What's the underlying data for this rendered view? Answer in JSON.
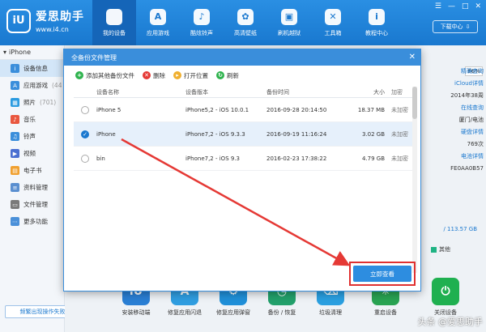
{
  "app": {
    "name": "爱思助手",
    "url": "www.i4.cn",
    "badge": "iU"
  },
  "nav": [
    {
      "label": "我的设备",
      "icon": "apple-icon",
      "glyph": ""
    },
    {
      "label": "应用游戏",
      "icon": "appstore-icon",
      "glyph": "A"
    },
    {
      "label": "酷炫铃声",
      "icon": "bell-icon",
      "glyph": "♪"
    },
    {
      "label": "高清壁纸",
      "icon": "flower-icon",
      "glyph": "✿"
    },
    {
      "label": "刷机越狱",
      "icon": "box-icon",
      "glyph": "▣"
    },
    {
      "label": "工具箱",
      "icon": "tools-icon",
      "glyph": "✕"
    },
    {
      "label": "教程中心",
      "icon": "info-icon",
      "glyph": "i"
    }
  ],
  "window_controls": [
    "☰",
    "—",
    "□",
    "✕"
  ],
  "download_label": "下载中心",
  "sidebar": {
    "device": "iPhone",
    "items": [
      {
        "label": "设备信息",
        "count": "",
        "color": "#3a8edb",
        "glyph": "i"
      },
      {
        "label": "应用游戏",
        "count": "(44",
        "color": "#3a8edb",
        "glyph": "A"
      },
      {
        "label": "照片",
        "count": "(701)",
        "color": "#2b9be0",
        "glyph": "▦"
      },
      {
        "label": "音乐",
        "count": "",
        "color": "#e9573f",
        "glyph": "♪"
      },
      {
        "label": "铃声",
        "count": "",
        "color": "#3a8edb",
        "glyph": "♫"
      },
      {
        "label": "视频",
        "count": "",
        "color": "#4a6fd1",
        "glyph": "▶"
      },
      {
        "label": "电子书",
        "count": "",
        "color": "#f0a030",
        "glyph": "▤"
      },
      {
        "label": "资料管理",
        "count": "",
        "color": "#5a8fd0",
        "glyph": "≡"
      },
      {
        "label": "文件管理",
        "count": "",
        "color": "#7a7a7a",
        "glyph": "▭"
      },
      {
        "label": "更多功能",
        "count": "",
        "color": "#4a90d9",
        "glyph": "⋯"
      }
    ],
    "feedback": "频繁出现操作失败？"
  },
  "right_panel": {
    "percent": "86%",
    "lines": [
      {
        "text": "",
        "val": "精确查询",
        "link": true
      },
      {
        "text": "",
        "val": "iCloud详情",
        "link": true
      },
      {
        "text": "",
        "val": "2014年38周",
        "link": false
      },
      {
        "text": "",
        "val": "在线查询",
        "link": true
      },
      {
        "text": "",
        "val": "厦门/电池",
        "link": false
      },
      {
        "text": "",
        "val": "硬盘详情",
        "link": true
      },
      {
        "text": "",
        "val": "769次",
        "link": false
      },
      {
        "text": "",
        "val": "电池详情",
        "link": true
      },
      {
        "text": "",
        "val": "FE0AA0B57",
        "link": false
      }
    ],
    "storage": "/ 113.57 GB",
    "legend_other": "其他"
  },
  "tools": [
    {
      "label": "安装移动端",
      "color": "#2a7fd4",
      "glyph": "iU"
    },
    {
      "label": "修复应用闪退",
      "color": "#2f9de0",
      "glyph": "A"
    },
    {
      "label": "修复应用弹窗",
      "color": "#1f8fd8",
      "glyph": "⚙"
    },
    {
      "label": "备份 / 恢复",
      "color": "#22a06b",
      "glyph": "◷"
    },
    {
      "label": "垃圾清理",
      "color": "#2a9fe0",
      "glyph": "⌫"
    },
    {
      "label": "重启设备",
      "color": "#29a352",
      "glyph": "✳"
    },
    {
      "label": "关闭设备",
      "color": "#1fb050",
      "glyph": "⏻"
    }
  ],
  "modal": {
    "title": "全备份文件管理",
    "close": "✕",
    "toolbar": [
      {
        "label": "添加其他备份文件",
        "color": "#2fb34e",
        "glyph": "+",
        "icon": "add-icon"
      },
      {
        "label": "删除",
        "color": "#e53935",
        "glyph": "✕",
        "icon": "delete-icon"
      },
      {
        "label": "打开位置",
        "color": "#f0b030",
        "glyph": "▸",
        "icon": "folder-icon"
      },
      {
        "label": "刷新",
        "color": "#2fb34e",
        "glyph": "↻",
        "icon": "refresh-icon"
      }
    ],
    "columns": [
      "设备名称",
      "设备版本",
      "备份时间",
      "大小",
      "加密"
    ],
    "rows": [
      {
        "name": "iPhone 5",
        "version": "iPhone5,2 - iOS 10.0.1",
        "time": "2016-09-28 20:14:50",
        "size": "18.37 MB",
        "enc": "未加密",
        "selected": false
      },
      {
        "name": "iPhone",
        "version": "iPhone7,2 - iOS 9.3.3",
        "time": "2016-09-19 11:16:24",
        "size": "3.02 GB",
        "enc": "未加密",
        "selected": true
      },
      {
        "name": "bin",
        "version": "iPhone7,2 - iOS 9.3",
        "time": "2016-02-23 17:38:22",
        "size": "4.79 GB",
        "enc": "未加密",
        "selected": false
      }
    ],
    "view_button": "立即查看"
  },
  "watermark": "头条 @爱思助手"
}
